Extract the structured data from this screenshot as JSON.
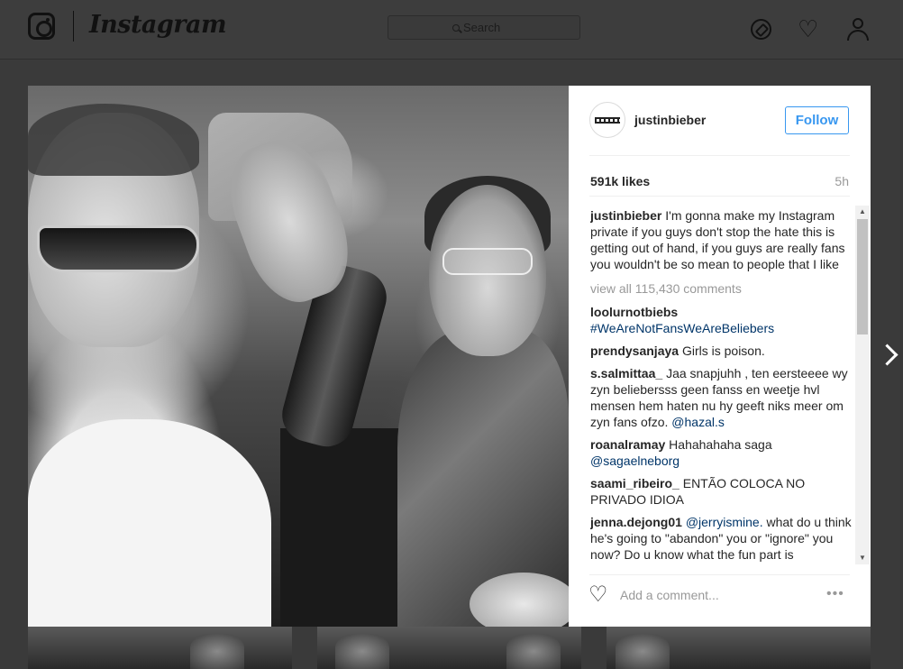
{
  "header": {
    "brand": "Instagram",
    "search_placeholder": "Search",
    "icons": [
      "instagram-camera-icon",
      "compass-icon",
      "heart-icon",
      "user-icon"
    ]
  },
  "post": {
    "username": "justinbieber",
    "follow_label": "Follow",
    "likes": "591k likes",
    "time_ago": "5h",
    "caption": {
      "author": "justinbieber",
      "text": "I'm gonna make my Instagram private if you guys don't stop the hate this is getting out of hand, if you guys are really fans you wouldn't be so mean to people that I like"
    },
    "view_all": "view all 115,430 comments",
    "comments": [
      {
        "author": "loolurnotbiebs",
        "text": "",
        "mention": "#WeAreNotFansWeAreBeliebers",
        "after": ""
      },
      {
        "author": "prendysanjaya",
        "text": "Girls is poison.",
        "mention": "",
        "after": ""
      },
      {
        "author": "s.salmittaa_",
        "text": "Jaa snapjuhh , ten eersteeee wy zyn beliebersss geen fanss en weetje hvl mensen hem haten nu hy geeft niks meer om zyn fans ofzo.",
        "mention": "@hazal.s",
        "after": ""
      },
      {
        "author": "roanalramay",
        "text": "Hahahahaha saga",
        "mention": "@sagaelneborg",
        "after": ""
      },
      {
        "author": "saami_ribeiro_",
        "text": "ENTÃO COLOCA NO PRIVADO IDIOA",
        "mention": "",
        "after": ""
      },
      {
        "author": "jenna.dejong01",
        "text": "",
        "mention": "@jerryismine.",
        "after": "  what do u think he's going to \"abandon\" you or \"ignore\" you now? Do u know what the fun part is"
      }
    ],
    "add_comment_placeholder": "Add a comment...",
    "more_label": "•••"
  },
  "icons": {
    "heart": "♡",
    "scroll_up": "▲",
    "scroll_down": "▼"
  },
  "colors": {
    "accent": "#3897f0",
    "mention": "#003569",
    "overlay": "#3a3a3a"
  }
}
